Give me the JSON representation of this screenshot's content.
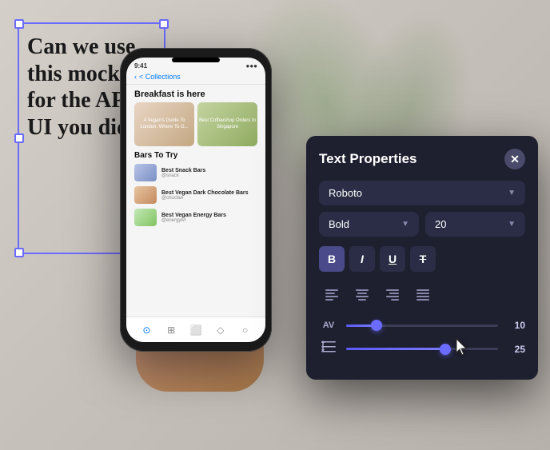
{
  "canvas": {
    "background_color": "#d4ccc4"
  },
  "text_box": {
    "content": "Can we use this mockup for the APP UI you did?",
    "border_color": "#6b6bff"
  },
  "phone": {
    "status_time": "9:41",
    "nav_back": "< Collections",
    "hero_title": "Breakfast is here",
    "card1_label": "A Vegan's Guide To London: Where To G...",
    "card2_label": "Best Coffeeshop Orders In Singapore",
    "section_title": "Bars To Try",
    "items": [
      {
        "name": "Best Snack Bars",
        "sub": "@snack"
      },
      {
        "name": "Best Vegan Dark Chocolate Bars",
        "sub": "@chocfan"
      },
      {
        "name": "Best Vegan Energy Bars",
        "sub": "@energylvr"
      }
    ]
  },
  "panel": {
    "title": "Text Properties",
    "close_icon": "✕",
    "font_family": "Roboto",
    "font_weight": "Bold",
    "font_size": "20",
    "format_buttons": [
      {
        "label": "B",
        "active": true,
        "name": "bold"
      },
      {
        "label": "I",
        "active": false,
        "name": "italic"
      },
      {
        "label": "U",
        "active": false,
        "name": "underline"
      },
      {
        "label": "S̶",
        "active": false,
        "name": "strikethrough"
      }
    ],
    "align_buttons": [
      {
        "label": "≡",
        "name": "align-left"
      },
      {
        "label": "≡",
        "name": "align-center"
      },
      {
        "label": "≡",
        "name": "align-right"
      },
      {
        "label": "≡",
        "name": "align-justify"
      }
    ],
    "kerning_label": "AV",
    "kerning_value": "10",
    "kerning_percent": 20,
    "line_height_label": "line-height",
    "line_height_value": "25",
    "line_height_percent": 65
  }
}
